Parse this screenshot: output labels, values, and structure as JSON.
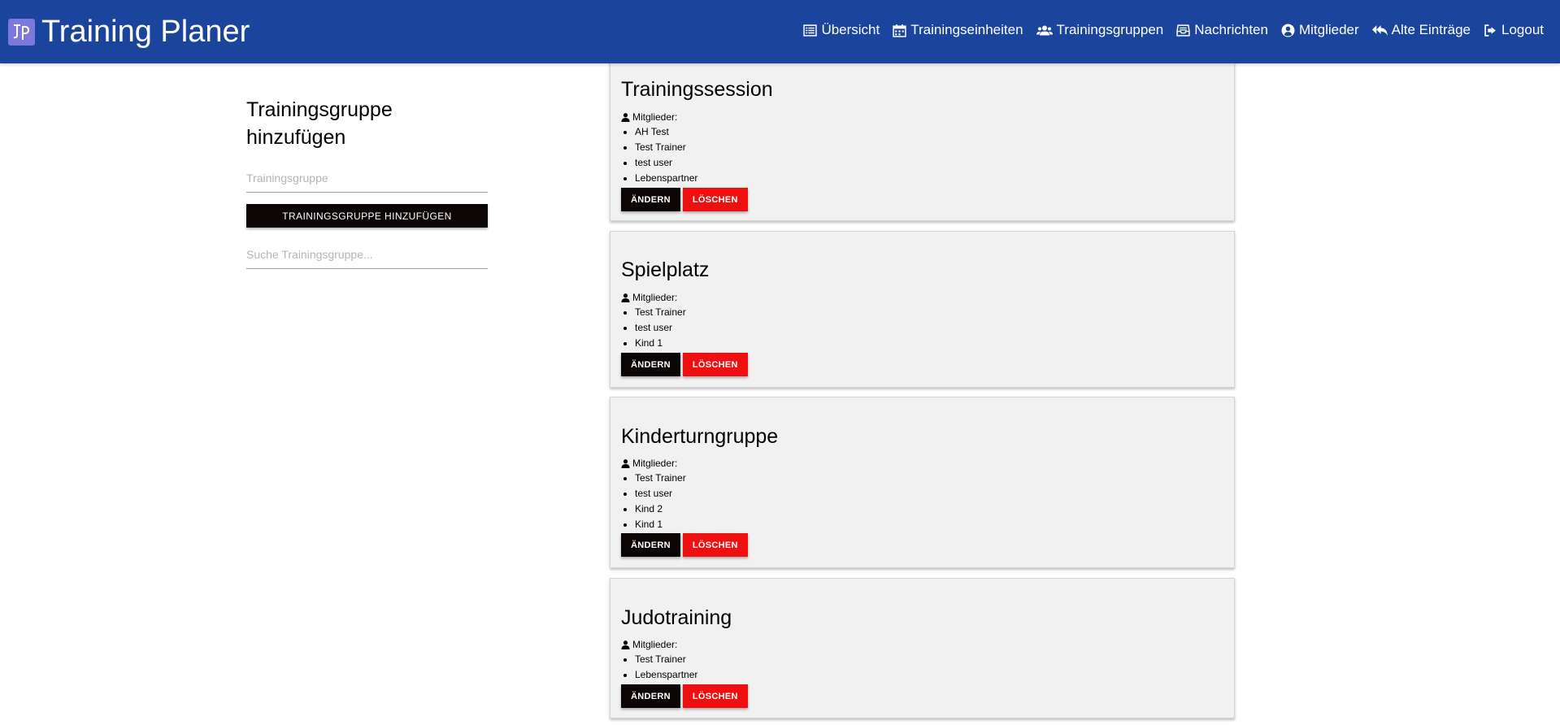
{
  "navbar": {
    "title": "Training Planer",
    "logo_icon": "jp-logo-icon",
    "items": [
      {
        "label": "Übersicht",
        "icon": "list-icon"
      },
      {
        "label": "Trainingseinheiten",
        "icon": "calendar-icon"
      },
      {
        "label": "Trainingsgruppen",
        "icon": "users-icon"
      },
      {
        "label": "Nachrichten",
        "icon": "inbox-icon"
      },
      {
        "label": "Mitglieder",
        "icon": "user-circle-icon"
      },
      {
        "label": "Alte Einträge",
        "icon": "reply-all-icon"
      },
      {
        "label": "Logout",
        "icon": "sign-out-icon"
      }
    ]
  },
  "form": {
    "title": "Trainingsgruppe hinzufügen",
    "group_placeholder": "Trainingsgruppe",
    "group_value": "",
    "add_button": "Trainingsgruppe hinzufügen",
    "search_placeholder": "Suche Trainingsgruppe...",
    "search_value": ""
  },
  "groups": [
    {
      "name": "Trainingssession",
      "members_label": "Mitglieder:",
      "members": [
        "AH Test",
        "Test Trainer",
        "test user",
        "Lebenspartner"
      ],
      "edit_label": "Ändern",
      "delete_label": "Löschen"
    },
    {
      "name": "Spielplatz",
      "members_label": "Mitglieder:",
      "members": [
        "Test Trainer",
        "test user",
        "Kind 1"
      ],
      "edit_label": "Ändern",
      "delete_label": "Löschen"
    },
    {
      "name": "Kinderturngruppe",
      "members_label": "Mitglieder:",
      "members": [
        "Test Trainer",
        "test user",
        "Kind 2",
        "Kind 1"
      ],
      "edit_label": "Ändern",
      "delete_label": "Löschen"
    },
    {
      "name": "Judotraining",
      "members_label": "Mitglieder:",
      "members": [
        "Test Trainer",
        "Lebenspartner"
      ],
      "edit_label": "Ändern",
      "delete_label": "Löschen"
    }
  ],
  "colors": {
    "navbar": "#1b449c",
    "logo_bg": "#7b79dd",
    "primary_button": "#0b0505",
    "delete_button": "#ee1010",
    "card_bg": "#f1f1f1"
  }
}
